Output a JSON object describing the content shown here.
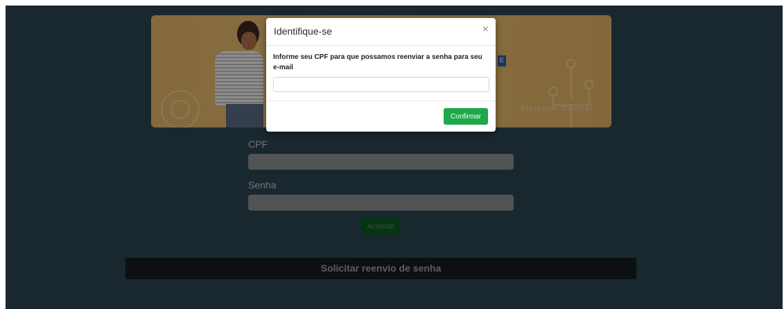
{
  "form": {
    "cpf_label": "CPF",
    "senha_label": "Senha",
    "access_button": "Acessar",
    "resend_button": "Solicitar reenvio de senha"
  },
  "banner": {
    "tag": "E",
    "footer_text": "Eleitoral Central"
  },
  "modal": {
    "title": "Identifique-se",
    "close_symbol": "×",
    "message": "Informe seu CPF para que possamos reenviar a senha para seu e-mail",
    "input_value": "",
    "confirm_button": "Confirmar"
  },
  "colors": {
    "page_background": "#2c4651",
    "confirm_green": "#1ea84b",
    "resend_bar": "#151d22"
  }
}
